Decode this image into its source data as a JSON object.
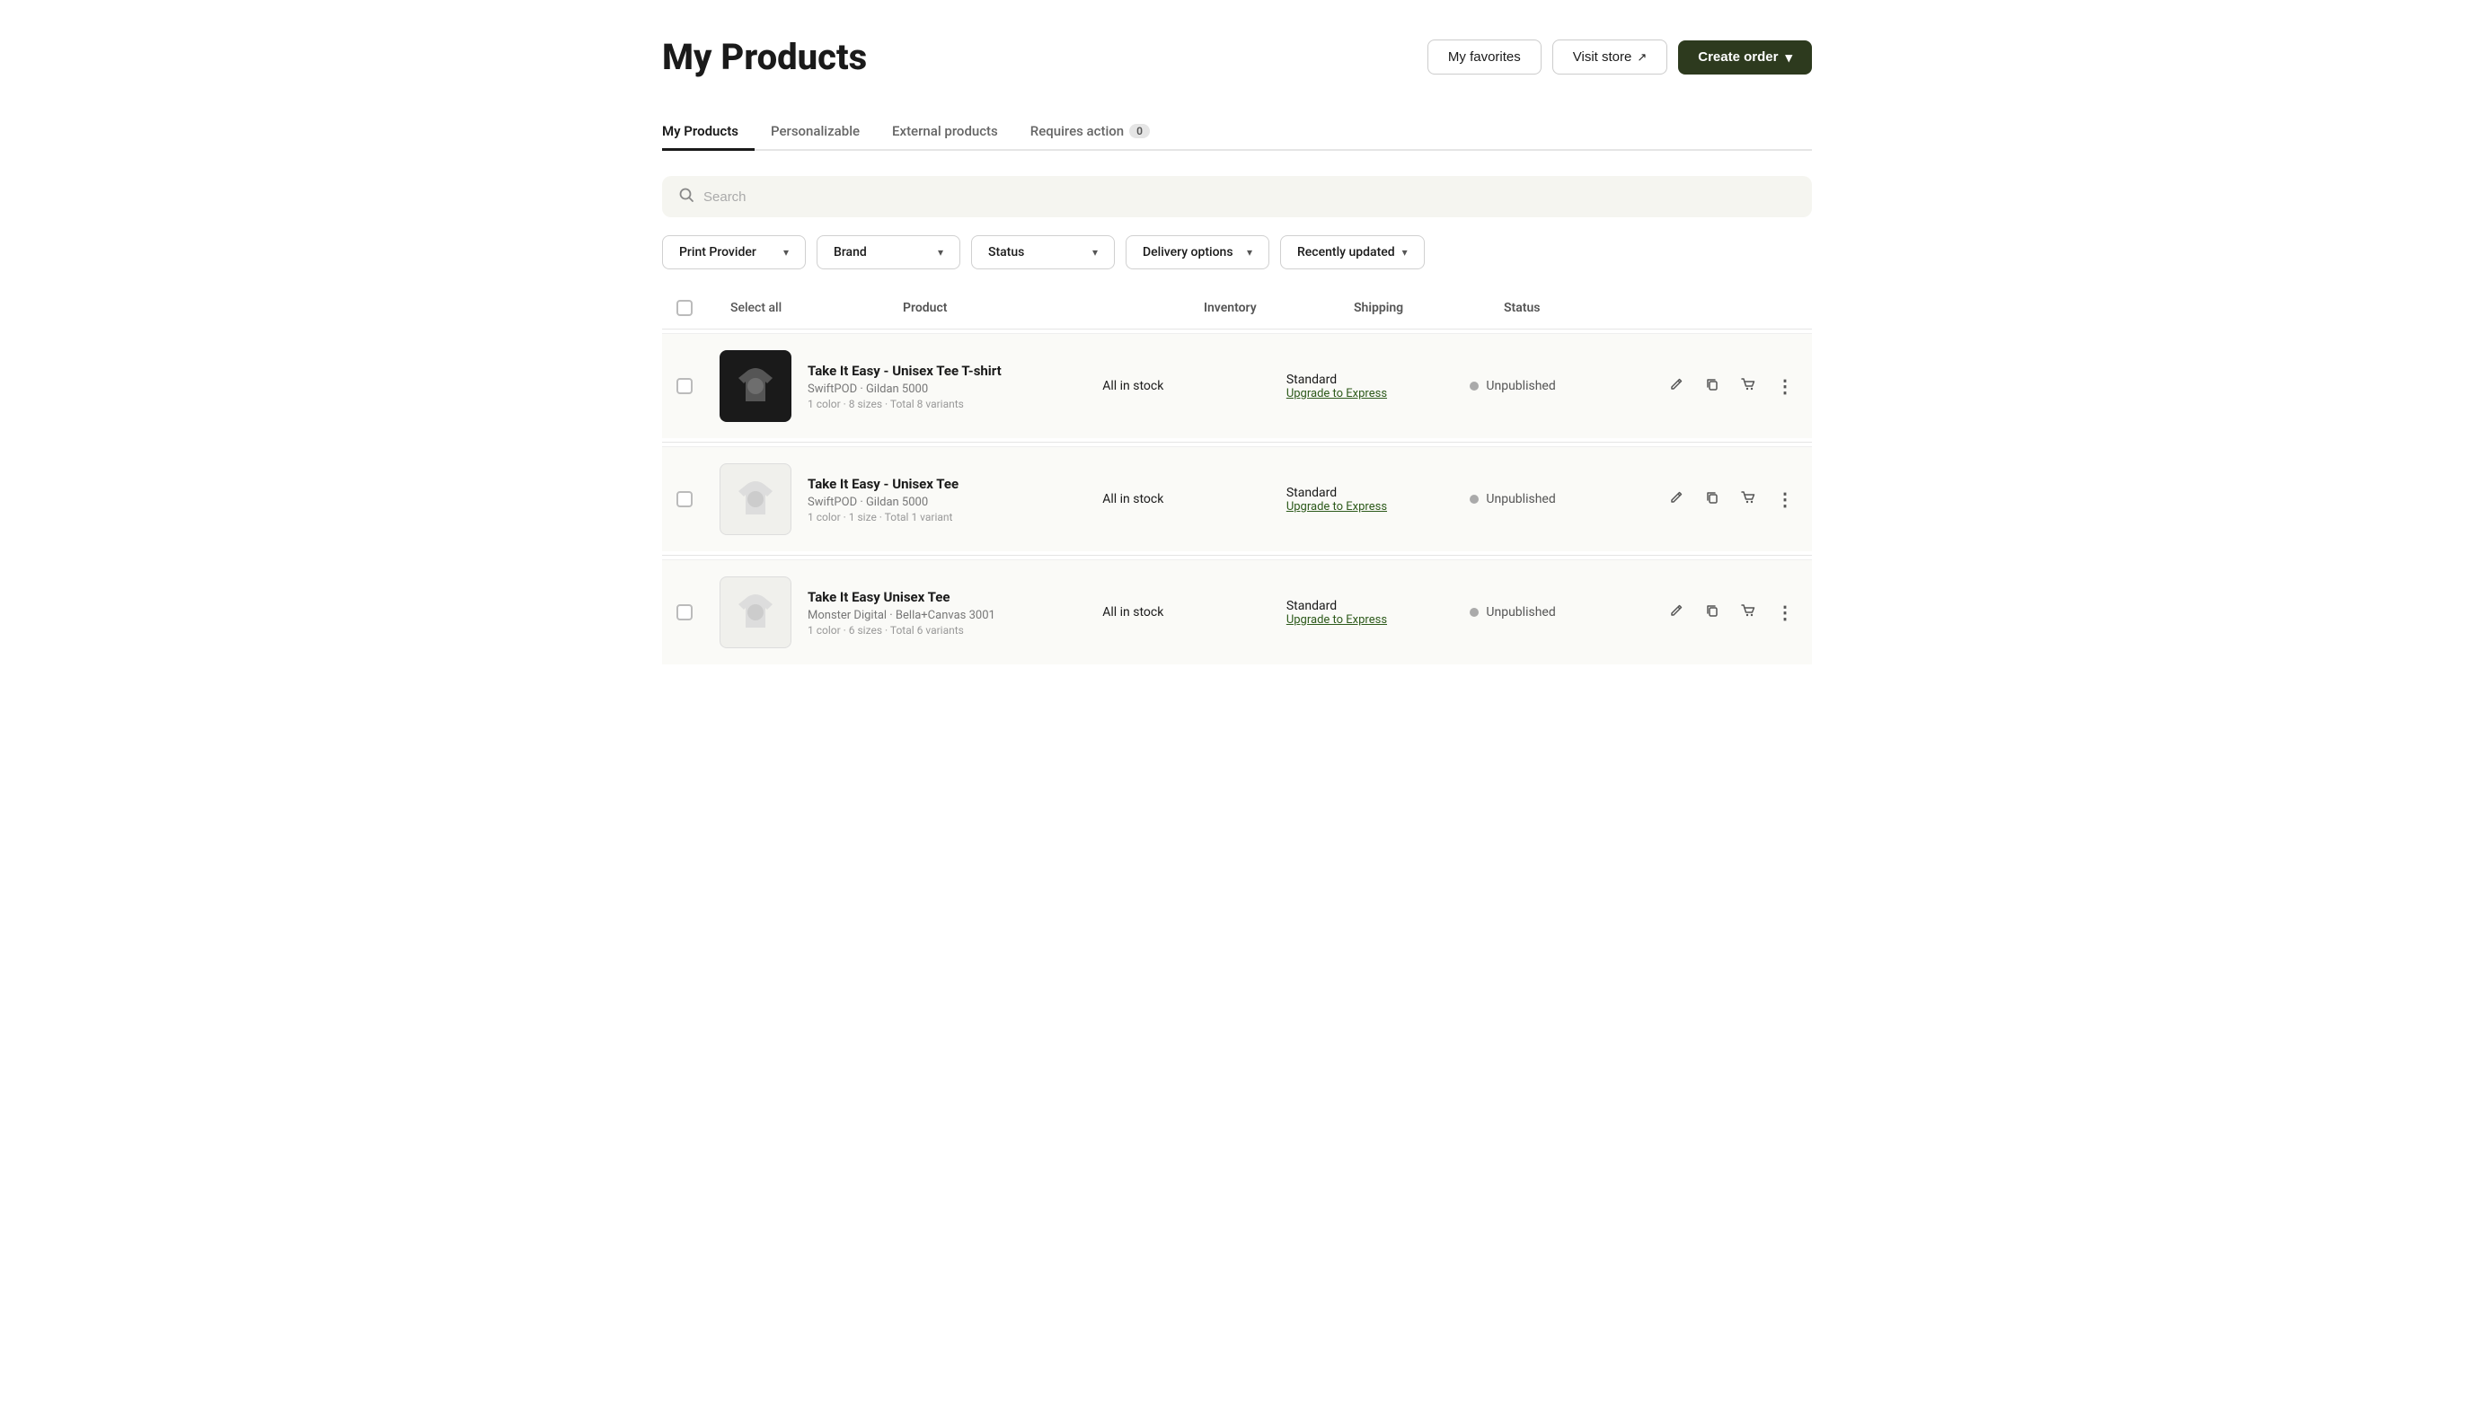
{
  "header": {
    "title": "My Products",
    "buttons": {
      "favorites": "My favorites",
      "visit_store": "Visit store",
      "create_order": "Create order"
    }
  },
  "tabs": [
    {
      "id": "my-products",
      "label": "My Products",
      "active": true,
      "badge": null
    },
    {
      "id": "personalizable",
      "label": "Personalizable",
      "active": false,
      "badge": null
    },
    {
      "id": "external-products",
      "label": "External products",
      "active": false,
      "badge": null
    },
    {
      "id": "requires-action",
      "label": "Requires action",
      "active": false,
      "badge": "0"
    }
  ],
  "search": {
    "placeholder": "Search"
  },
  "filters": [
    {
      "id": "print-provider",
      "label": "Print Provider"
    },
    {
      "id": "brand",
      "label": "Brand"
    },
    {
      "id": "status",
      "label": "Status"
    },
    {
      "id": "delivery-options",
      "label": "Delivery options"
    },
    {
      "id": "recently-updated",
      "label": "Recently updated"
    }
  ],
  "table": {
    "columns": {
      "product": "Product",
      "inventory": "Inventory",
      "shipping": "Shipping",
      "status": "Status"
    },
    "select_all": "Select all"
  },
  "products": [
    {
      "id": 1,
      "name": "Take It Easy - Unisex Tee T-shirt",
      "provider": "SwiftPOD",
      "model": "Gildan 5000",
      "colors": "1 color",
      "sizes": "8 sizes",
      "variants": "Total 8 variants",
      "inventory": "All in stock",
      "shipping_standard": "Standard",
      "shipping_upgrade": "Upgrade to Express",
      "status": "Unpublished",
      "image_bg": "dark"
    },
    {
      "id": 2,
      "name": "Take It Easy - Unisex Tee",
      "provider": "SwiftPOD",
      "model": "Gildan 5000",
      "colors": "1 color",
      "sizes": "1 size",
      "variants": "Total 1 variant",
      "inventory": "All in stock",
      "shipping_standard": "Standard",
      "shipping_upgrade": "Upgrade to Express",
      "status": "Unpublished",
      "image_bg": "light"
    },
    {
      "id": 3,
      "name": "Take It Easy Unisex Tee",
      "provider": "Monster Digital",
      "model": "Bella+Canvas 3001",
      "colors": "1 color",
      "sizes": "6 sizes",
      "variants": "Total 6 variants",
      "inventory": "All in stock",
      "shipping_standard": "Standard",
      "shipping_upgrade": "Upgrade to Express",
      "status": "Unpublished",
      "image_bg": "light"
    }
  ],
  "icons": {
    "search": "🔍",
    "chevron_down": "▾",
    "external_link": "↗",
    "edit": "✏",
    "copy": "⧉",
    "cart": "🛒",
    "more": "⋮",
    "create_order_arrow": "▾"
  }
}
